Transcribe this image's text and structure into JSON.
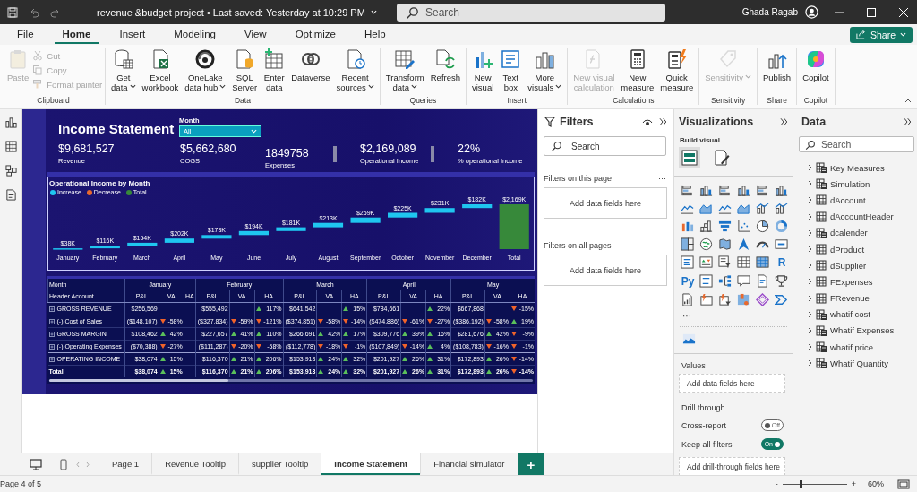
{
  "title_bar": {
    "document": "revenue &budget project • Last saved: Yesterday at 10:29 PM",
    "search": {
      "placeholder": "Search"
    },
    "user": "Ghada Ragab"
  },
  "menu": {
    "tabs": [
      {
        "label": "File",
        "selected": false
      },
      {
        "label": "Home",
        "selected": true
      },
      {
        "label": "Insert",
        "selected": false
      },
      {
        "label": "Modeling",
        "selected": false
      },
      {
        "label": "View",
        "selected": false
      },
      {
        "label": "Optimize",
        "selected": false
      },
      {
        "label": "Help",
        "selected": false
      }
    ],
    "share": "Share"
  },
  "ribbon": {
    "groups": [
      {
        "label": "Clipboard",
        "buttons": [
          {
            "kind": "large",
            "lines": [
              "Paste"
            ],
            "disabled": true,
            "dropdown": false
          },
          {
            "kind": "small",
            "lines": [
              "Cut"
            ],
            "disabled": true,
            "dropdown": false
          },
          {
            "kind": "small",
            "lines": [
              "Copy"
            ],
            "disabled": true,
            "dropdown": false
          },
          {
            "kind": "small",
            "lines": [
              "Format painter"
            ],
            "disabled": true,
            "dropdown": false
          }
        ]
      },
      {
        "label": "Data",
        "buttons": [
          {
            "kind": "large",
            "lines": [
              "Get",
              "data"
            ],
            "disabled": false,
            "dropdown": true
          },
          {
            "kind": "large",
            "lines": [
              "Excel",
              "workbook"
            ],
            "disabled": false,
            "dropdown": false
          },
          {
            "kind": "large",
            "lines": [
              "OneLake",
              "data hub"
            ],
            "disabled": false,
            "dropdown": true
          },
          {
            "kind": "large",
            "lines": [
              "SQL",
              "Server"
            ],
            "disabled": false,
            "dropdown": false
          },
          {
            "kind": "large",
            "lines": [
              "Enter",
              "data"
            ],
            "disabled": false,
            "dropdown": false
          },
          {
            "kind": "large",
            "lines": [
              "Dataverse"
            ],
            "disabled": false,
            "dropdown": false
          },
          {
            "kind": "large",
            "lines": [
              "Recent",
              "sources"
            ],
            "disabled": false,
            "dropdown": true
          }
        ]
      },
      {
        "label": "Queries",
        "buttons": [
          {
            "kind": "large",
            "lines": [
              "Transform",
              "data"
            ],
            "disabled": false,
            "dropdown": true
          },
          {
            "kind": "large",
            "lines": [
              "Refresh"
            ],
            "disabled": false,
            "dropdown": false
          }
        ]
      },
      {
        "label": "Insert",
        "buttons": [
          {
            "kind": "large",
            "lines": [
              "New",
              "visual"
            ],
            "disabled": false,
            "dropdown": false
          },
          {
            "kind": "large",
            "lines": [
              "Text",
              "box"
            ],
            "disabled": false,
            "dropdown": false
          },
          {
            "kind": "large",
            "lines": [
              "More",
              "visuals"
            ],
            "disabled": false,
            "dropdown": true
          }
        ]
      },
      {
        "label": "Calculations",
        "buttons": [
          {
            "kind": "large",
            "lines": [
              "New visual",
              "calculation"
            ],
            "disabled": true,
            "dropdown": false
          },
          {
            "kind": "large",
            "lines": [
              "New",
              "measure"
            ],
            "disabled": false,
            "dropdown": false
          },
          {
            "kind": "large",
            "lines": [
              "Quick",
              "measure"
            ],
            "disabled": false,
            "dropdown": false
          }
        ]
      },
      {
        "label": "Sensitivity",
        "buttons": [
          {
            "kind": "large",
            "lines": [
              "Sensitivity"
            ],
            "disabled": true,
            "dropdown": true
          }
        ]
      },
      {
        "label": "Share",
        "buttons": [
          {
            "kind": "large",
            "lines": [
              "Publish"
            ],
            "disabled": false,
            "dropdown": false
          }
        ]
      },
      {
        "label": "Copilot",
        "buttons": [
          {
            "kind": "large",
            "lines": [
              "Copilot"
            ],
            "disabled": false,
            "dropdown": false
          }
        ]
      }
    ]
  },
  "report": {
    "title": "Income Statement",
    "slicer": {
      "label": "Month",
      "value": "All"
    },
    "kpis": [
      {
        "value": "$9,681,527",
        "label": "Revenue",
        "divider": false
      },
      {
        "value": "$5,662,680",
        "label": "COGS",
        "divider": false
      },
      {
        "value": "1849758",
        "label": "Expenses",
        "divider": false
      },
      {
        "value": "$2,169,089",
        "label": "Operational Income",
        "divider": true
      },
      {
        "value": "22%",
        "label": "% operational Income",
        "divider": true
      }
    ],
    "chart_data": {
      "type": "other",
      "title": "Operational Income by Month",
      "categories": [
        "January",
        "February",
        "March",
        "April",
        "May",
        "June",
        "July",
        "August",
        "September",
        "October",
        "November",
        "December",
        "Total"
      ],
      "values": [
        38,
        116,
        154,
        202,
        173,
        194,
        181,
        213,
        259,
        225,
        231,
        182,
        2169
      ],
      "value_labels": [
        "$38K",
        "$116K",
        "$154K",
        "$202K",
        "$173K",
        "$194K",
        "$181K",
        "$213K",
        "$259K",
        "$225K",
        "$231K",
        "$182K",
        "$2,169K"
      ]
    },
    "chart_legend": [
      {
        "label": "Increase",
        "color": "#1fc6f0",
        "kind": "increase"
      },
      {
        "label": "Decrease",
        "color": "#e8692d",
        "kind": "decrease"
      },
      {
        "label": "Total",
        "color": "#37893a",
        "kind": "total"
      }
    ],
    "matrix": {
      "corner": [
        "Month",
        "Header Account"
      ],
      "months": [
        "January",
        "February",
        "March",
        "April",
        "May"
      ],
      "subheaders": [
        "P&L",
        "VA",
        "HA",
        "P&L",
        "VA",
        "HA",
        "P&L",
        "VA",
        "HA",
        "P&L",
        "VA",
        "HA",
        "P&L",
        "VA",
        "HA"
      ],
      "rows": [
        {
          "account": "GROSS REVENUE",
          "expandable": true,
          "total": false,
          "months": [
            {
              "pl": "$256,569"
            },
            {
              "pl": "$555,492",
              "ha": {
                "text": "117%",
                "up": true
              }
            },
            {
              "pl": "$641,542",
              "ha": {
                "text": "15%",
                "up": true
              }
            },
            {
              "pl": "$784,661",
              "ha": {
                "text": "22%",
                "up": true
              }
            },
            {
              "pl": "$667,868",
              "ha": {
                "text": "-15%",
                "up": false
              }
            }
          ]
        },
        {
          "account": "(-) Cost of Sales",
          "expandable": true,
          "total": false,
          "months": [
            {
              "pl": "($148,107)",
              "va": {
                "text": "-58%",
                "up": false
              }
            },
            {
              "pl": "($327,834)",
              "va": {
                "text": "-59%",
                "up": false
              },
              "ha": {
                "text": "-121%",
                "up": false
              }
            },
            {
              "pl": "($374,851)",
              "va": {
                "text": "-58%",
                "up": false
              },
              "ha": {
                "text": "-14%",
                "up": false
              }
            },
            {
              "pl": "($474,886)",
              "va": {
                "text": "-61%",
                "up": false
              },
              "ha": {
                "text": "-27%",
                "up": false
              }
            },
            {
              "pl": "($386,192)",
              "va": {
                "text": "-58%",
                "up": false
              },
              "ha": {
                "text": "19%",
                "up": true
              }
            }
          ]
        },
        {
          "account": "GROSS MARGIN",
          "expandable": true,
          "total": false,
          "months": [
            {
              "pl": "$108,462",
              "va": {
                "text": "42%",
                "up": true
              }
            },
            {
              "pl": "$227,657",
              "va": {
                "text": "41%",
                "up": true
              },
              "ha": {
                "text": "110%",
                "up": true
              }
            },
            {
              "pl": "$266,691",
              "va": {
                "text": "42%",
                "up": true
              },
              "ha": {
                "text": "17%",
                "up": true
              }
            },
            {
              "pl": "$309,776",
              "va": {
                "text": "39%",
                "up": true
              },
              "ha": {
                "text": "16%",
                "up": true
              }
            },
            {
              "pl": "$281,676",
              "va": {
                "text": "42%",
                "up": true
              },
              "ha": {
                "text": "-9%",
                "up": false
              }
            }
          ]
        },
        {
          "account": "(-) Operating Expenses",
          "expandable": true,
          "total": false,
          "months": [
            {
              "pl": "($70,388)",
              "va": {
                "text": "-27%",
                "up": false
              }
            },
            {
              "pl": "($111,287)",
              "va": {
                "text": "-20%",
                "up": false
              },
              "ha": {
                "text": "-58%",
                "up": false
              }
            },
            {
              "pl": "($112,778)",
              "va": {
                "text": "-18%",
                "up": false
              },
              "ha": {
                "text": "-1%",
                "up": false
              }
            },
            {
              "pl": "($107,849)",
              "va": {
                "text": "-14%",
                "up": false
              },
              "ha": {
                "text": "4%",
                "up": true
              }
            },
            {
              "pl": "($108,783)",
              "va": {
                "text": "-16%",
                "up": false
              },
              "ha": {
                "text": "-1%",
                "up": false
              }
            }
          ]
        },
        {
          "account": "OPERATING INCOME",
          "expandable": true,
          "total": false,
          "months": [
            {
              "pl": "$38,074",
              "va": {
                "text": "15%",
                "up": true
              }
            },
            {
              "pl": "$116,370",
              "va": {
                "text": "21%",
                "up": true
              },
              "ha": {
                "text": "206%",
                "up": true
              }
            },
            {
              "pl": "$153,913",
              "va": {
                "text": "24%",
                "up": true
              },
              "ha": {
                "text": "32%",
                "up": true
              }
            },
            {
              "pl": "$201,927",
              "va": {
                "text": "26%",
                "up": true
              },
              "ha": {
                "text": "31%",
                "up": true
              }
            },
            {
              "pl": "$172,893",
              "va": {
                "text": "26%",
                "up": true
              },
              "ha": {
                "text": "-14%",
                "up": false
              }
            }
          ]
        },
        {
          "account": "Total",
          "expandable": false,
          "total": true,
          "months": [
            {
              "pl": "$38,074",
              "va": {
                "text": "15%",
                "up": true
              }
            },
            {
              "pl": "$116,370",
              "va": {
                "text": "21%",
                "up": true
              },
              "ha": {
                "text": "206%",
                "up": true
              }
            },
            {
              "pl": "$153,913",
              "va": {
                "text": "24%",
                "up": true
              },
              "ha": {
                "text": "32%",
                "up": true
              }
            },
            {
              "pl": "$201,927",
              "va": {
                "text": "26%",
                "up": true
              },
              "ha": {
                "text": "31%",
                "up": true
              }
            },
            {
              "pl": "$172,893",
              "va": {
                "text": "26%",
                "up": true
              },
              "ha": {
                "text": "-14%",
                "up": false
              }
            }
          ]
        }
      ]
    }
  },
  "filters": {
    "title": "Filters",
    "search": {
      "placeholder": "Search"
    },
    "sections": [
      {
        "label": "Filters on this page",
        "more": "···",
        "drop": "Add data fields here"
      },
      {
        "label": "Filters on all pages",
        "more": "···",
        "drop": "Add data fields here"
      }
    ]
  },
  "visualizations": {
    "title": "Visualizations",
    "subtitle": "Build visual",
    "modes": [
      {
        "selected": true
      },
      {
        "selected": false
      }
    ],
    "letter_icons": [
      "R",
      "Py"
    ],
    "more": "···",
    "wells": [
      {
        "label": "Values",
        "drop": "Add data fields here"
      }
    ],
    "drill": {
      "label": "Drill through",
      "toggles": [
        {
          "label": "Cross-report",
          "on": false,
          "text": "Off"
        },
        {
          "label": "Keep all filters",
          "on": true,
          "text": "On"
        }
      ],
      "drop": "Add drill-through fields here"
    }
  },
  "data": {
    "title": "Data",
    "search": {
      "placeholder": "Search"
    },
    "tables": [
      {
        "name": "Key Measures",
        "kind": "measures"
      },
      {
        "name": "Simulation",
        "kind": "measures"
      },
      {
        "name": "dAccount",
        "kind": "table"
      },
      {
        "name": "dAccountHeader",
        "kind": "table"
      },
      {
        "name": "dcalender",
        "kind": "measures"
      },
      {
        "name": "dProduct",
        "kind": "table"
      },
      {
        "name": "dSupplier",
        "kind": "table"
      },
      {
        "name": "FExpenses",
        "kind": "table"
      },
      {
        "name": "FRevenue",
        "kind": "table"
      },
      {
        "name": "whatif cost",
        "kind": "measures"
      },
      {
        "name": "Whatif Expenses",
        "kind": "measures"
      },
      {
        "name": "whatif price",
        "kind": "measures"
      },
      {
        "name": "Whatif Quantity",
        "kind": "measures"
      }
    ]
  },
  "pages": {
    "tabs": [
      {
        "label": "Page 1",
        "selected": false
      },
      {
        "label": "Revenue Tooltip",
        "selected": false
      },
      {
        "label": "supplier Tooltip",
        "selected": false
      },
      {
        "label": "Income Statement",
        "selected": true
      },
      {
        "label": "Financial simulator",
        "selected": false
      }
    ],
    "add": "+"
  },
  "status": {
    "page": "Page 4 of 5",
    "zoom": {
      "minus": "-",
      "plus": "+",
      "level": 0.28,
      "reading": "60%"
    }
  }
}
